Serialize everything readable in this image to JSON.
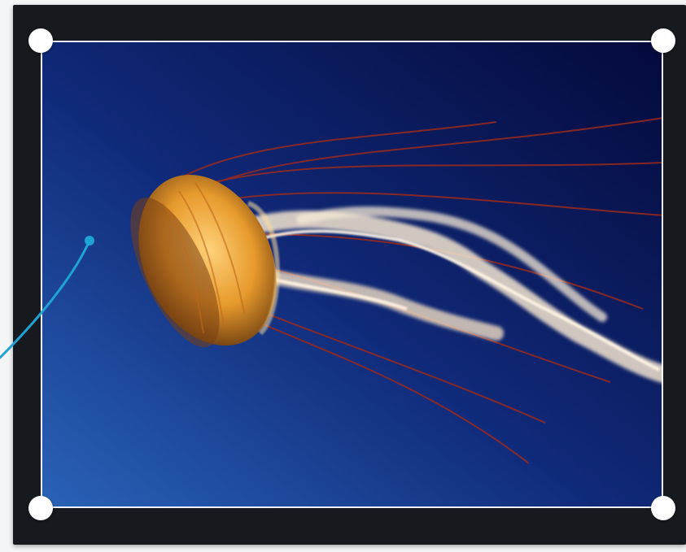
{
  "editor": {
    "frame_color": "#16191d",
    "handle_color": "#ffffff",
    "connector_color": "#1fa3d6",
    "image": {
      "subject": "jellyfish-photo",
      "background_gradient": [
        "#2a63b8",
        "#04093a"
      ]
    },
    "crop_handles": [
      "top-left",
      "top-right",
      "bottom-left",
      "bottom-right"
    ]
  }
}
